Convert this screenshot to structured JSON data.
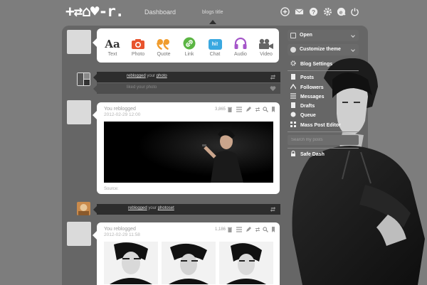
{
  "app": {
    "logo_text": "+⇄⌂♥-r.",
    "nav_dashboard": "Dashboard",
    "nav_blog_title": "blogs title"
  },
  "top_icons": [
    "new-post-icon",
    "mail-icon",
    "help-icon",
    "settings-icon",
    "tumblr-e-icon",
    "power-icon"
  ],
  "post_types": [
    {
      "label": "Text",
      "glyph": "Aa",
      "icon": "text-icon",
      "color": "#333333"
    },
    {
      "label": "Photo",
      "icon": "camera-icon",
      "color": "#e8542e"
    },
    {
      "label": "Quote",
      "icon": "quote-icon",
      "color": "#f09c2d"
    },
    {
      "label": "Link",
      "icon": "link-icon",
      "color": "#5bb543"
    },
    {
      "label": "Chat",
      "glyph": "hi!",
      "icon": "chat-icon",
      "color": "#3aa8e0"
    },
    {
      "label": "Audio",
      "icon": "headphones-icon",
      "color": "#a556c9"
    },
    {
      "label": "Video",
      "icon": "video-camera-icon",
      "color": "#666666"
    }
  ],
  "notifications": [
    {
      "action": "reblogged",
      "connector": "your",
      "object": "photo",
      "icon": "reblog-icon"
    },
    {
      "action": "liked",
      "connector": "your",
      "object": "photo",
      "icon": "heart-icon"
    },
    {
      "action": "reblogged",
      "connector": "your",
      "object": "photoset",
      "icon": "reblog-icon"
    }
  ],
  "posts": [
    {
      "title": "You reblogged",
      "date": "2012-02-29 12:00",
      "notes": "3,865",
      "source_label": "Source:"
    },
    {
      "title": "You reblogged",
      "date": "2012-02-29 11:58",
      "notes": "1,186"
    }
  ],
  "sidebar": {
    "open_label": "Open",
    "customize_label": "Customize theme",
    "blog_settings_label": "Blog Settings",
    "items": [
      {
        "label": "Posts",
        "icon": "posts-icon"
      },
      {
        "label": "Followers",
        "icon": "followers-icon"
      },
      {
        "label": "Messages",
        "icon": "messages-icon"
      },
      {
        "label": "Drafts",
        "icon": "drafts-icon"
      },
      {
        "label": "Queue",
        "icon": "queue-icon"
      },
      {
        "label": "Mass Post Editor",
        "icon": "mass-editor-icon"
      }
    ],
    "search_placeholder": "Search my posts",
    "safe_dash_label": "Safe Dash"
  },
  "colors": {
    "page_bg": "#7d7d7d",
    "column_bg": "#666666",
    "notification_dark": "#2d2d2d"
  }
}
